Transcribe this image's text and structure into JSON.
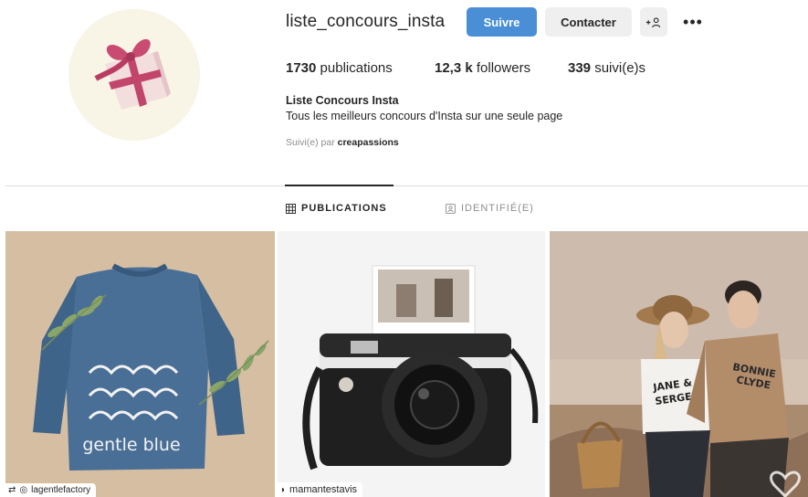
{
  "profile": {
    "username": "liste_concours_insta",
    "follow_label": "Suivre",
    "contact_label": "Contacter",
    "add_user_icon": "+♀",
    "more_icon": "•••",
    "stats": {
      "posts_count": "1730",
      "posts_label": " publications",
      "followers_count": "12,3 k",
      "followers_label": " followers",
      "following_count": "339",
      "following_label": " suivi(e)s"
    },
    "bio_name": "Liste Concours Insta",
    "bio_text": "Tous les meilleurs concours d'Insta sur une seule page",
    "followed_by_prefix": "Suivi(e) par ",
    "followed_by_user": "creapassions"
  },
  "tabs": {
    "publications": "PUBLICATIONS",
    "tagged": "IDENTIFIÉ(E)"
  },
  "posts": [
    {
      "caption_text": "gentle blue",
      "tag_user": "lagentlefactory"
    },
    {
      "tag_user": "mamantestavis"
    },
    {
      "shirt_text_1": "JANE &",
      "shirt_text_2": "SERGE",
      "shirt_text_3": "BONNIE",
      "shirt_text_4": "CLYDE"
    }
  ],
  "colors": {
    "follow_blue": "#4a8fd6",
    "gift_ribbon": "#c2456b",
    "sweater_blue": "#4a6f96"
  }
}
